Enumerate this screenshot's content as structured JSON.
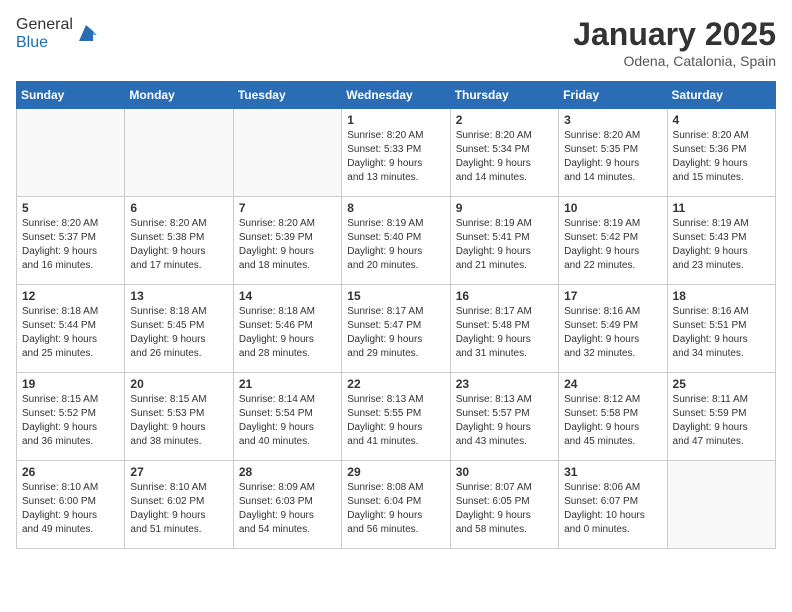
{
  "header": {
    "logo_general": "General",
    "logo_blue": "Blue",
    "month_title": "January 2025",
    "location": "Odena, Catalonia, Spain"
  },
  "weekdays": [
    "Sunday",
    "Monday",
    "Tuesday",
    "Wednesday",
    "Thursday",
    "Friday",
    "Saturday"
  ],
  "weeks": [
    [
      {
        "day": "",
        "info": ""
      },
      {
        "day": "",
        "info": ""
      },
      {
        "day": "",
        "info": ""
      },
      {
        "day": "1",
        "info": "Sunrise: 8:20 AM\nSunset: 5:33 PM\nDaylight: 9 hours\nand 13 minutes."
      },
      {
        "day": "2",
        "info": "Sunrise: 8:20 AM\nSunset: 5:34 PM\nDaylight: 9 hours\nand 14 minutes."
      },
      {
        "day": "3",
        "info": "Sunrise: 8:20 AM\nSunset: 5:35 PM\nDaylight: 9 hours\nand 14 minutes."
      },
      {
        "day": "4",
        "info": "Sunrise: 8:20 AM\nSunset: 5:36 PM\nDaylight: 9 hours\nand 15 minutes."
      }
    ],
    [
      {
        "day": "5",
        "info": "Sunrise: 8:20 AM\nSunset: 5:37 PM\nDaylight: 9 hours\nand 16 minutes."
      },
      {
        "day": "6",
        "info": "Sunrise: 8:20 AM\nSunset: 5:38 PM\nDaylight: 9 hours\nand 17 minutes."
      },
      {
        "day": "7",
        "info": "Sunrise: 8:20 AM\nSunset: 5:39 PM\nDaylight: 9 hours\nand 18 minutes."
      },
      {
        "day": "8",
        "info": "Sunrise: 8:19 AM\nSunset: 5:40 PM\nDaylight: 9 hours\nand 20 minutes."
      },
      {
        "day": "9",
        "info": "Sunrise: 8:19 AM\nSunset: 5:41 PM\nDaylight: 9 hours\nand 21 minutes."
      },
      {
        "day": "10",
        "info": "Sunrise: 8:19 AM\nSunset: 5:42 PM\nDaylight: 9 hours\nand 22 minutes."
      },
      {
        "day": "11",
        "info": "Sunrise: 8:19 AM\nSunset: 5:43 PM\nDaylight: 9 hours\nand 23 minutes."
      }
    ],
    [
      {
        "day": "12",
        "info": "Sunrise: 8:18 AM\nSunset: 5:44 PM\nDaylight: 9 hours\nand 25 minutes."
      },
      {
        "day": "13",
        "info": "Sunrise: 8:18 AM\nSunset: 5:45 PM\nDaylight: 9 hours\nand 26 minutes."
      },
      {
        "day": "14",
        "info": "Sunrise: 8:18 AM\nSunset: 5:46 PM\nDaylight: 9 hours\nand 28 minutes."
      },
      {
        "day": "15",
        "info": "Sunrise: 8:17 AM\nSunset: 5:47 PM\nDaylight: 9 hours\nand 29 minutes."
      },
      {
        "day": "16",
        "info": "Sunrise: 8:17 AM\nSunset: 5:48 PM\nDaylight: 9 hours\nand 31 minutes."
      },
      {
        "day": "17",
        "info": "Sunrise: 8:16 AM\nSunset: 5:49 PM\nDaylight: 9 hours\nand 32 minutes."
      },
      {
        "day": "18",
        "info": "Sunrise: 8:16 AM\nSunset: 5:51 PM\nDaylight: 9 hours\nand 34 minutes."
      }
    ],
    [
      {
        "day": "19",
        "info": "Sunrise: 8:15 AM\nSunset: 5:52 PM\nDaylight: 9 hours\nand 36 minutes."
      },
      {
        "day": "20",
        "info": "Sunrise: 8:15 AM\nSunset: 5:53 PM\nDaylight: 9 hours\nand 38 minutes."
      },
      {
        "day": "21",
        "info": "Sunrise: 8:14 AM\nSunset: 5:54 PM\nDaylight: 9 hours\nand 40 minutes."
      },
      {
        "day": "22",
        "info": "Sunrise: 8:13 AM\nSunset: 5:55 PM\nDaylight: 9 hours\nand 41 minutes."
      },
      {
        "day": "23",
        "info": "Sunrise: 8:13 AM\nSunset: 5:57 PM\nDaylight: 9 hours\nand 43 minutes."
      },
      {
        "day": "24",
        "info": "Sunrise: 8:12 AM\nSunset: 5:58 PM\nDaylight: 9 hours\nand 45 minutes."
      },
      {
        "day": "25",
        "info": "Sunrise: 8:11 AM\nSunset: 5:59 PM\nDaylight: 9 hours\nand 47 minutes."
      }
    ],
    [
      {
        "day": "26",
        "info": "Sunrise: 8:10 AM\nSunset: 6:00 PM\nDaylight: 9 hours\nand 49 minutes."
      },
      {
        "day": "27",
        "info": "Sunrise: 8:10 AM\nSunset: 6:02 PM\nDaylight: 9 hours\nand 51 minutes."
      },
      {
        "day": "28",
        "info": "Sunrise: 8:09 AM\nSunset: 6:03 PM\nDaylight: 9 hours\nand 54 minutes."
      },
      {
        "day": "29",
        "info": "Sunrise: 8:08 AM\nSunset: 6:04 PM\nDaylight: 9 hours\nand 56 minutes."
      },
      {
        "day": "30",
        "info": "Sunrise: 8:07 AM\nSunset: 6:05 PM\nDaylight: 9 hours\nand 58 minutes."
      },
      {
        "day": "31",
        "info": "Sunrise: 8:06 AM\nSunset: 6:07 PM\nDaylight: 10 hours\nand 0 minutes."
      },
      {
        "day": "",
        "info": ""
      }
    ]
  ]
}
